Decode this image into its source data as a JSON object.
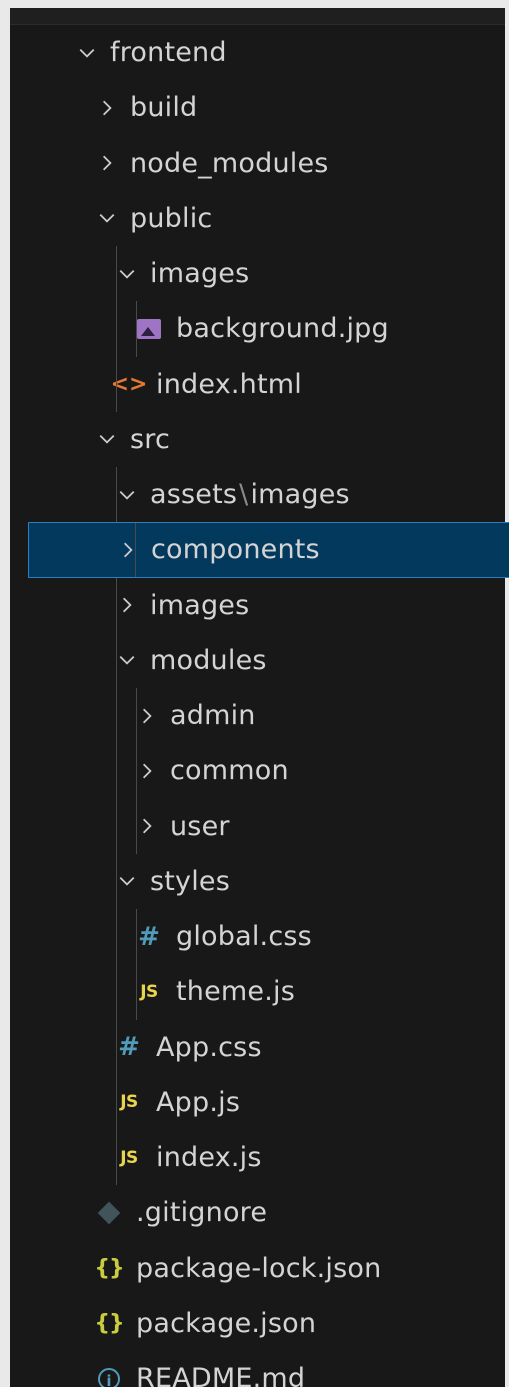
{
  "explorer": {
    "items": [
      {
        "label": "frontend",
        "depth": 0,
        "kind": "folder",
        "expanded": true
      },
      {
        "label": "build",
        "depth": 1,
        "kind": "folder",
        "expanded": false
      },
      {
        "label": "node_modules",
        "depth": 1,
        "kind": "folder",
        "expanded": false
      },
      {
        "label": "public",
        "depth": 1,
        "kind": "folder",
        "expanded": true
      },
      {
        "label": "images",
        "depth": 2,
        "kind": "folder",
        "expanded": true
      },
      {
        "label": "background.jpg",
        "depth": 3,
        "kind": "file",
        "icon": "image-icon"
      },
      {
        "label": "index.html",
        "depth": 2,
        "kind": "file",
        "icon": "html-icon"
      },
      {
        "label": "src",
        "depth": 1,
        "kind": "folder",
        "expanded": true
      },
      {
        "label": "assets",
        "label_suffix": "images",
        "depth": 2,
        "kind": "folder",
        "expanded": true
      },
      {
        "label": "components",
        "depth": 2,
        "kind": "folder",
        "expanded": false,
        "selected": true
      },
      {
        "label": "images",
        "depth": 2,
        "kind": "folder",
        "expanded": false
      },
      {
        "label": "modules",
        "depth": 2,
        "kind": "folder",
        "expanded": true
      },
      {
        "label": "admin",
        "depth": 3,
        "kind": "folder",
        "expanded": false
      },
      {
        "label": "common",
        "depth": 3,
        "kind": "folder",
        "expanded": false
      },
      {
        "label": "user",
        "depth": 3,
        "kind": "folder",
        "expanded": false
      },
      {
        "label": "styles",
        "depth": 2,
        "kind": "folder",
        "expanded": true
      },
      {
        "label": "global.css",
        "depth": 3,
        "kind": "file",
        "icon": "css-hash-icon"
      },
      {
        "label": "theme.js",
        "depth": 3,
        "kind": "file",
        "icon": "js-icon"
      },
      {
        "label": "App.css",
        "depth": 2,
        "kind": "file",
        "icon": "css-hash-icon"
      },
      {
        "label": "App.js",
        "depth": 2,
        "kind": "file",
        "icon": "js-icon"
      },
      {
        "label": "index.js",
        "depth": 2,
        "kind": "file",
        "icon": "js-icon"
      },
      {
        "label": ".gitignore",
        "depth": 1,
        "kind": "file",
        "icon": "git-icon"
      },
      {
        "label": "package-lock.json",
        "depth": 1,
        "kind": "file",
        "icon": "json-braces-icon"
      },
      {
        "label": "package.json",
        "depth": 1,
        "kind": "file",
        "icon": "json-braces-icon"
      },
      {
        "label": "README.md",
        "depth": 1,
        "kind": "file",
        "icon": "info-icon"
      }
    ]
  },
  "icons": {
    "css_glyph": "#",
    "js_glyph": "JS",
    "html_glyph": "<>",
    "json_glyph": "{}",
    "info_glyph": "i",
    "path_separator": "\\"
  },
  "colors": {
    "background": "#181818",
    "selection_bg": "#04395e",
    "selection_border": "#2a7fc1",
    "text": "#d4d4d4",
    "css": "#519aba",
    "js": "#e8d44d",
    "html": "#e37933",
    "json": "#cbcb41",
    "image": "#a074c4"
  }
}
